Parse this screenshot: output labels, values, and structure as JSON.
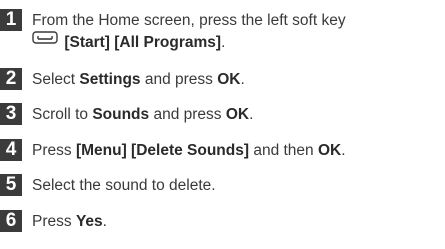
{
  "steps": [
    {
      "number": "1",
      "parts": [
        "From the Home screen, press the left soft key"
      ],
      "line2": [
        "[Start]",
        "[All Programs]",
        "."
      ],
      "icon": "left-soft-key-icon"
    },
    {
      "number": "2",
      "parts": [
        "Select ",
        "Settings",
        " and press ",
        "OK",
        "."
      ]
    },
    {
      "number": "3",
      "parts": [
        "Scroll to ",
        "Sounds",
        " and press ",
        "OK",
        "."
      ]
    },
    {
      "number": "4",
      "parts": [
        "Press ",
        "[Menu] [Delete Sounds]",
        " and then ",
        "OK",
        "."
      ]
    },
    {
      "number": "5",
      "parts": [
        "Select the sound to delete."
      ]
    },
    {
      "number": "6",
      "parts": [
        "Press ",
        "Yes",
        "."
      ]
    }
  ],
  "colors": {
    "number_badge_bg": "#3b3b3b",
    "number_badge_text": "#ffffff",
    "body_text": "#3a3a3a"
  }
}
